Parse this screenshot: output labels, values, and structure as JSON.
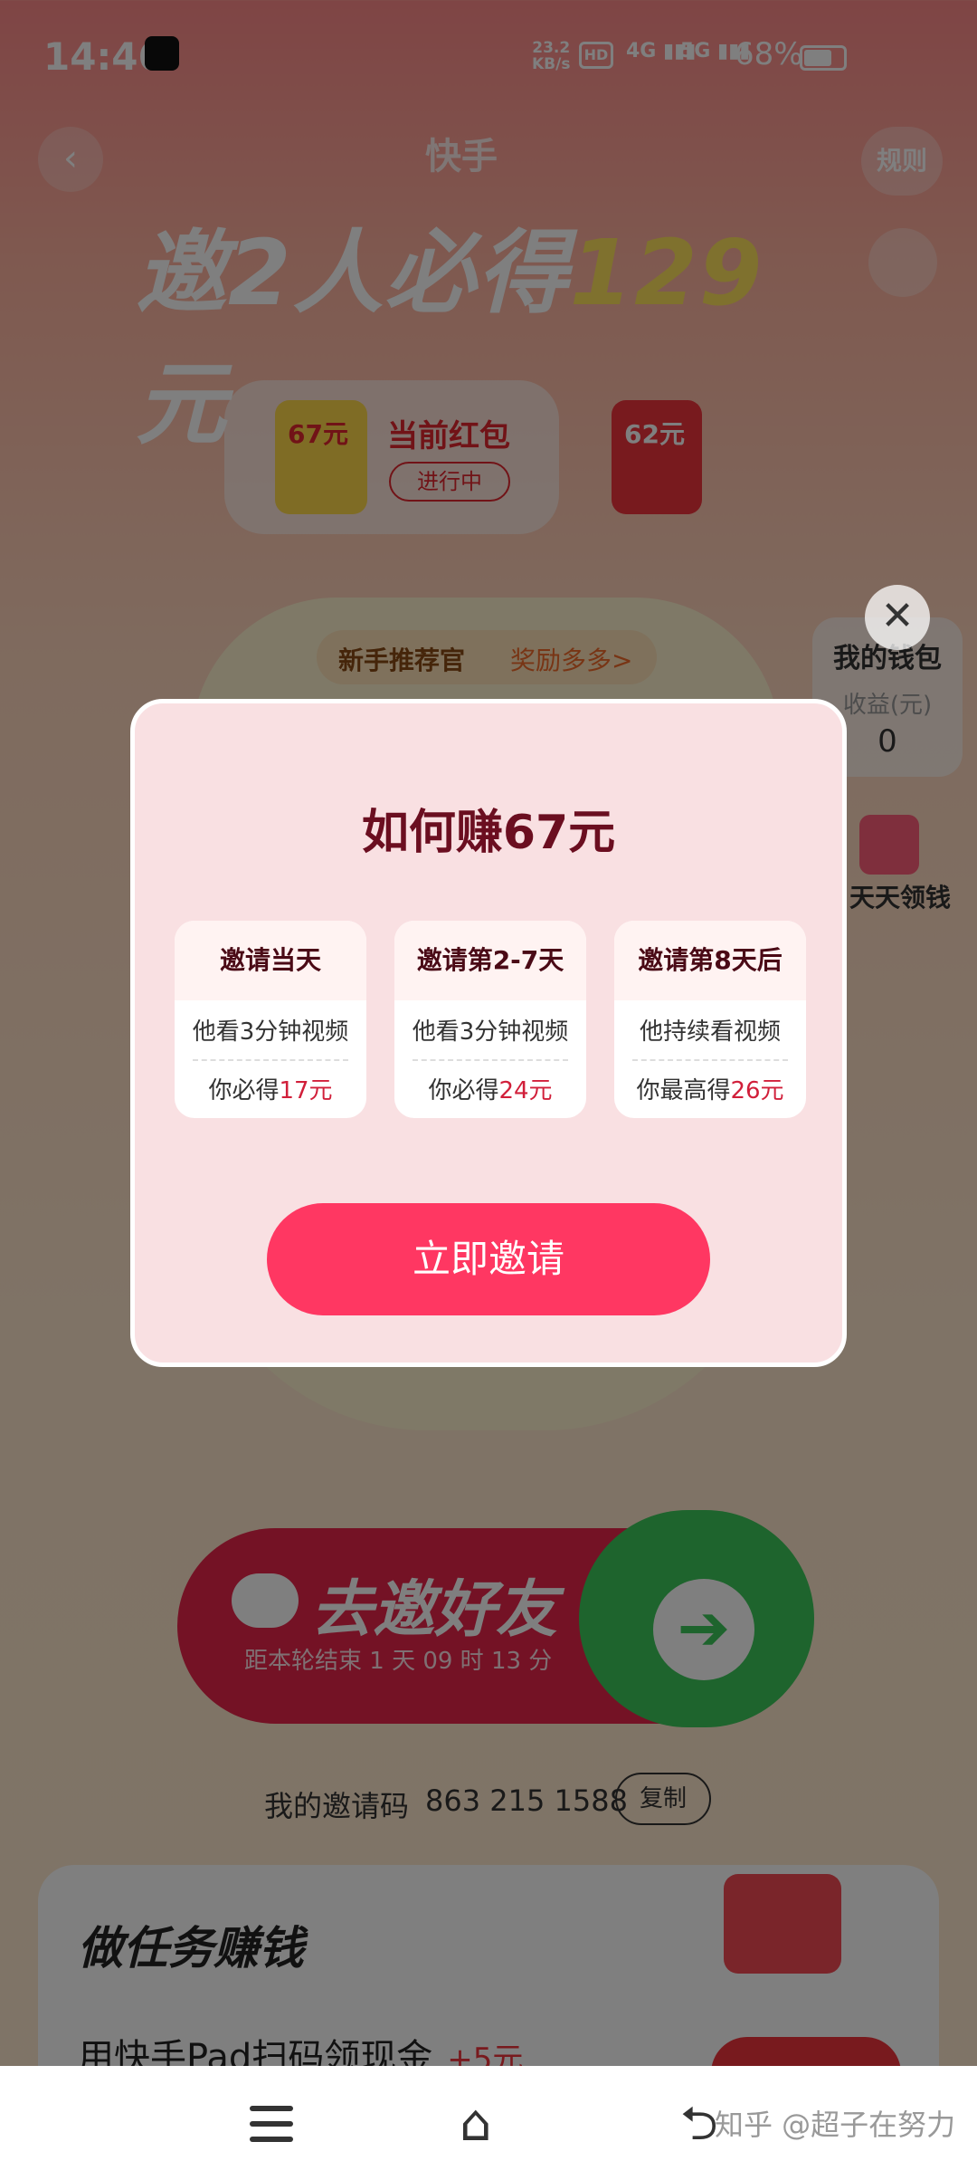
{
  "status_bar": {
    "time": "14:46",
    "net_rate": "23.2",
    "net_unit": "KB/s",
    "hd": "HD",
    "sig1": "4G",
    "sig2": "5G",
    "battery": "68%"
  },
  "header": {
    "back_icon": "‹",
    "app_name": "快手",
    "rules_label": "规则",
    "headline_prefix": "邀2人必得",
    "headline_amount": "129",
    "headline_suffix": "元"
  },
  "envelopes": {
    "env1_value": "67元",
    "current_label": "当前红包",
    "current_status": "进行中",
    "env2_value": "62元"
  },
  "promo": {
    "tag_label": "新手推荐官",
    "tag_link": "奖励多多>",
    "wallet_title": "我的钱包",
    "wallet_income_label": "收益(元)",
    "wallet_income_value": "0",
    "daily_label": "天天领钱"
  },
  "invite_cta": {
    "title": "去邀好友",
    "countdown": "距本轮结束 1 天 09 时 13 分",
    "arrow_icon": "➔"
  },
  "invite_code": {
    "label": "我的邀请码",
    "value": "863 215 1588",
    "copy_label": "复制"
  },
  "tasks": {
    "title": "做任务赚钱",
    "item1": "用快手Pad扫码领现金",
    "item1_bonus": "+5元"
  },
  "modal": {
    "close_icon": "✕",
    "title": "如何赚67元",
    "steps": [
      {
        "head": "邀请当天",
        "line1": "他看3分钟视频",
        "line2_prefix": "你必得",
        "line2_money": "17元"
      },
      {
        "head": "邀请第2-7天",
        "line1": "他看3分钟视频",
        "line2_prefix": "你必得",
        "line2_money": "24元"
      },
      {
        "head": "邀请第8天后",
        "line1": "他持续看视频",
        "line2_prefix": "你最高得",
        "line2_money": "26元"
      }
    ],
    "button_label": "立即邀请"
  },
  "nav": {
    "home_icon": "⌂",
    "back_icon": "⮌",
    "watermark": "知乎 @超子在努力"
  },
  "colors": {
    "accent": "#ff3762",
    "modal_bg": "#f9e0e2",
    "title_color": "#6b0e20",
    "money_color": "#d11f3a"
  }
}
